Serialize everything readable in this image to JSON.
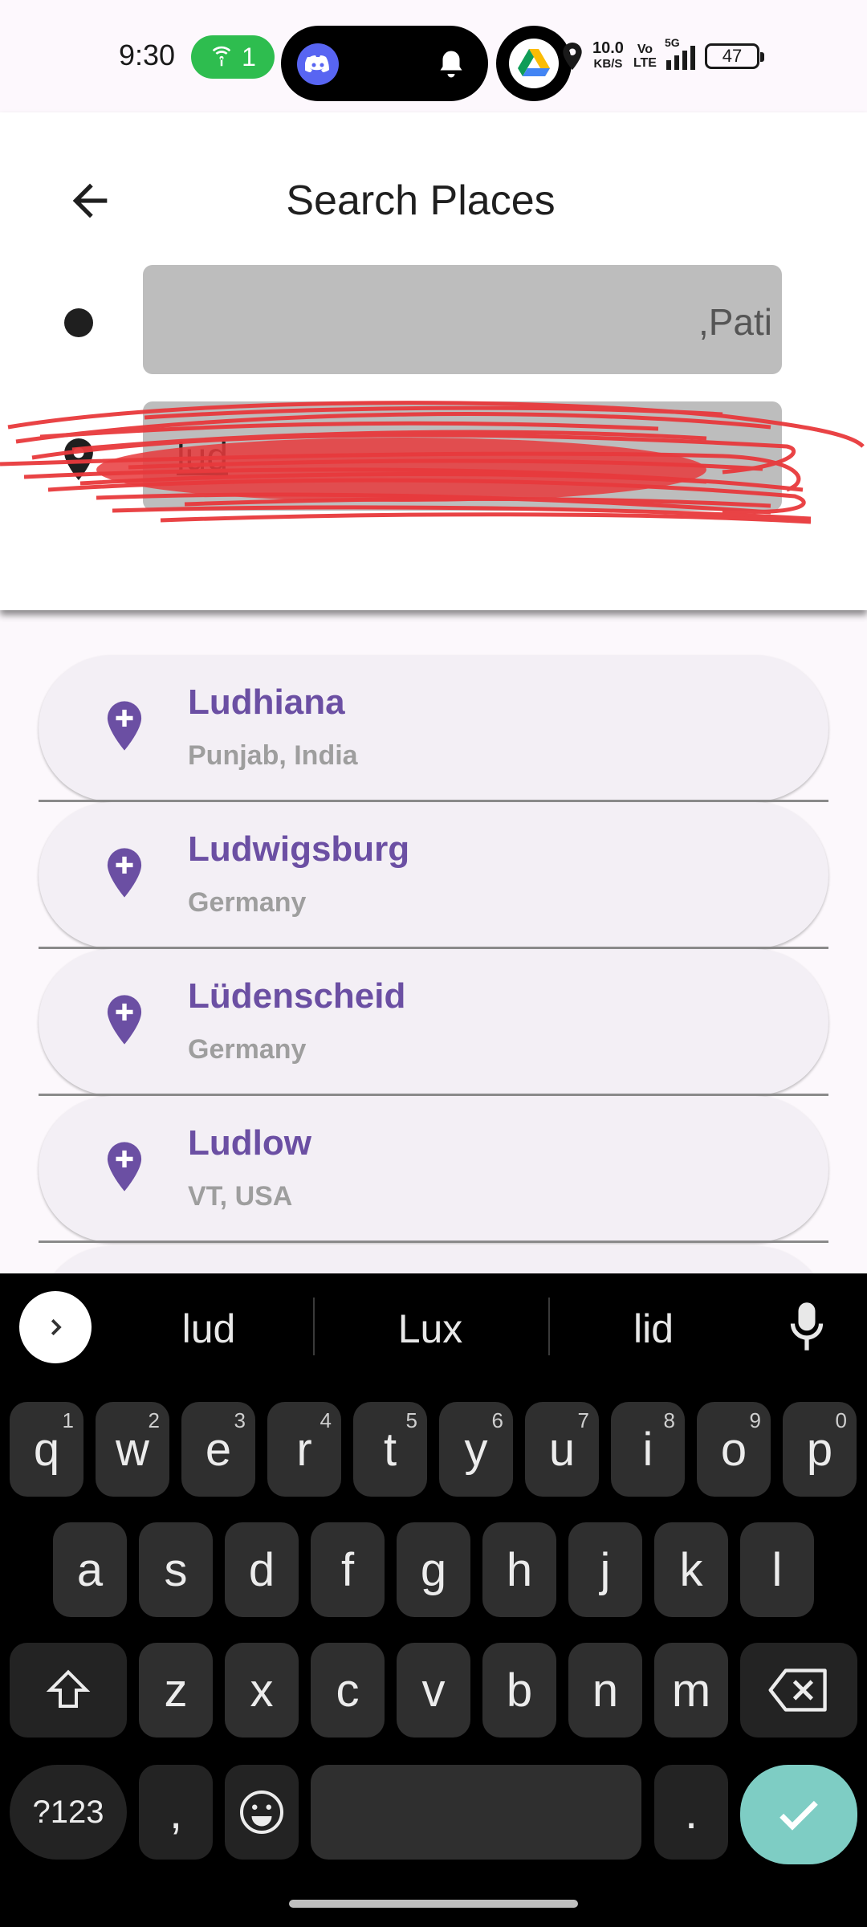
{
  "status_bar": {
    "time": "9:30",
    "hotspot_count": "1",
    "net_speed_value": "10.0",
    "net_speed_unit": "KB/S",
    "volte_top": "Vo",
    "volte_bottom": "LTE",
    "network": "5G",
    "battery": "47",
    "icons": [
      "wifi-hotspot-icon",
      "discord-icon",
      "bell-icon",
      "google-drive-icon",
      "location-icon",
      "signal-icon",
      "battery-icon"
    ]
  },
  "header": {
    "title": "Search Places",
    "back_icon": "arrow-left-icon"
  },
  "search": {
    "origin_visible_text": ",Pati",
    "destination_value": "lud",
    "origin_icon": "circle-icon",
    "destination_icon": "map-pin-icon"
  },
  "results": [
    {
      "title": "Ludhiana",
      "subtitle": "Punjab, India"
    },
    {
      "title": "Ludwigsburg",
      "subtitle": "Germany"
    },
    {
      "title": "Lüdenscheid",
      "subtitle": "Germany"
    },
    {
      "title": "Ludlow",
      "subtitle": "VT, USA"
    }
  ],
  "keyboard": {
    "suggestions": [
      "lud",
      "Lux",
      "lid"
    ],
    "row1": [
      {
        "key": "q",
        "hint": "1"
      },
      {
        "key": "w",
        "hint": "2"
      },
      {
        "key": "e",
        "hint": "3"
      },
      {
        "key": "r",
        "hint": "4"
      },
      {
        "key": "t",
        "hint": "5"
      },
      {
        "key": "y",
        "hint": "6"
      },
      {
        "key": "u",
        "hint": "7"
      },
      {
        "key": "i",
        "hint": "8"
      },
      {
        "key": "o",
        "hint": "9"
      },
      {
        "key": "p",
        "hint": "0"
      }
    ],
    "row2": [
      "a",
      "s",
      "d",
      "f",
      "g",
      "h",
      "j",
      "k",
      "l"
    ],
    "row3": [
      "z",
      "x",
      "c",
      "v",
      "b",
      "n",
      "m"
    ],
    "symbols_label": "?123",
    "comma": ",",
    "period": "."
  },
  "colors": {
    "accent": "#6b4fa3",
    "result_bg": "#f3eff5",
    "field_bg": "#bdbdbd",
    "enter_key": "#7ecdc4",
    "hotspot": "#2ebd4f"
  }
}
